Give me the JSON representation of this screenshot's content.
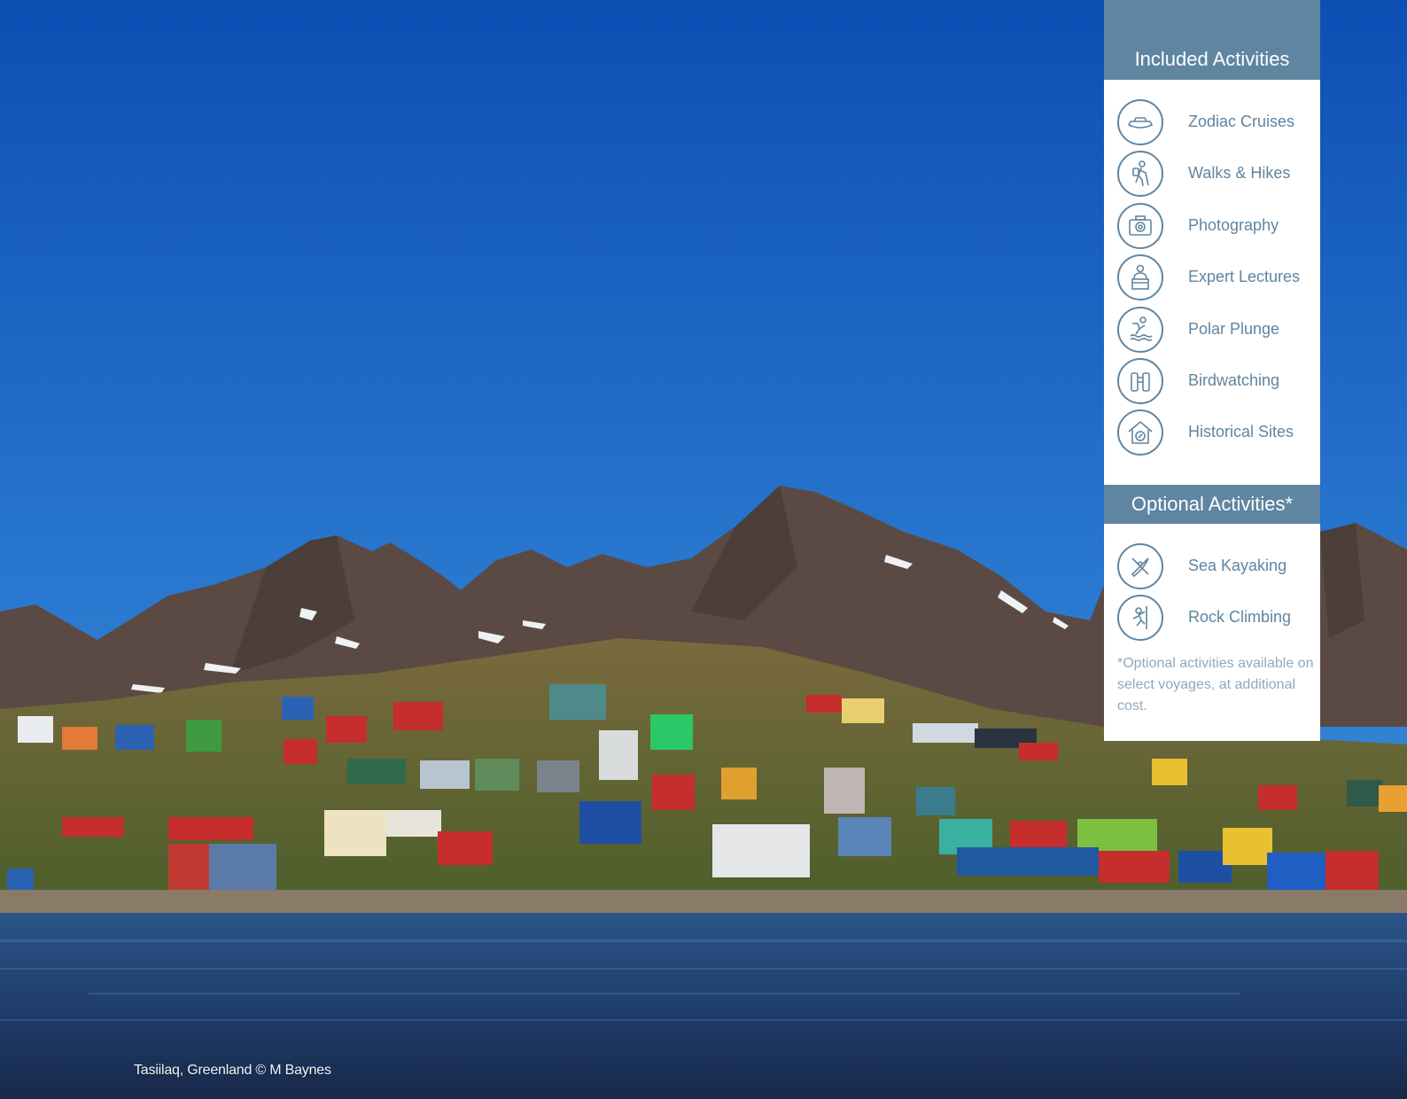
{
  "photo": {
    "subject": "tasiilaq-coastal-village-photo",
    "caption": "Tasiilaq, Greenland © M Baynes",
    "colors": {
      "sky_top": "#0f55b8",
      "sky_bottom": "#3a8ad8",
      "mountain": "#5a4a42",
      "hillside": "#5c6b32",
      "water": "#23426e"
    }
  },
  "panel": {
    "accent_color": "#5f85a1",
    "included": {
      "heading": "Included Activities",
      "items": [
        {
          "label": "Zodiac Cruises",
          "icon": "zodiac-boat-icon"
        },
        {
          "label": "Walks & Hikes",
          "icon": "hiker-icon"
        },
        {
          "label": "Photography",
          "icon": "camera-icon"
        },
        {
          "label": "Expert Lectures",
          "icon": "lecturer-icon"
        },
        {
          "label": "Polar Plunge",
          "icon": "plunge-swimmer-icon"
        },
        {
          "label": "Birdwatching",
          "icon": "binoculars-icon"
        },
        {
          "label": "Historical Sites",
          "icon": "historic-house-icon"
        }
      ]
    },
    "optional": {
      "heading": "Optional Activities*",
      "items": [
        {
          "label": "Sea Kayaking",
          "icon": "kayak-icon"
        },
        {
          "label": "Rock Climbing",
          "icon": "climber-icon"
        }
      ],
      "footnote": "*Optional activities available on select voyages, at additional cost."
    }
  }
}
